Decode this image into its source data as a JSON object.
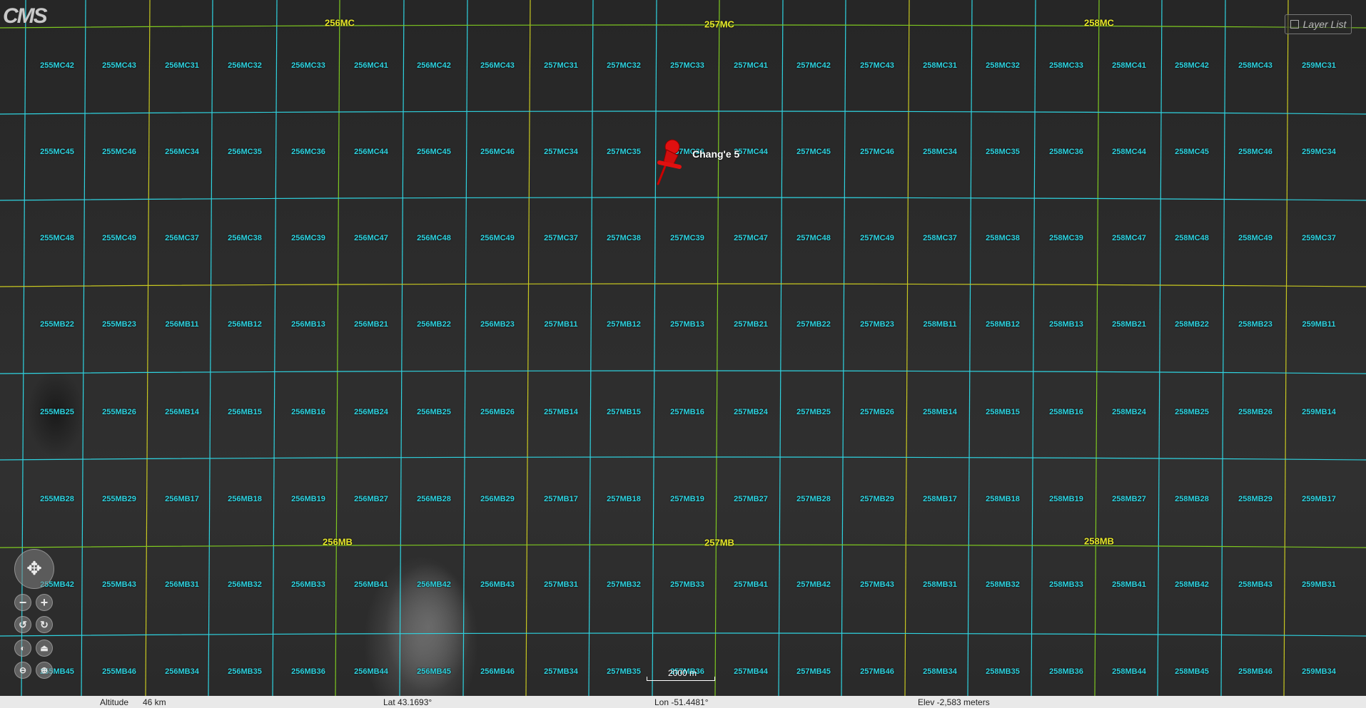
{
  "app": {
    "logo_text": "CMS"
  },
  "layer_list": {
    "label": "Layer List"
  },
  "marker": {
    "label": "Chang'e 5",
    "color": "#e01010"
  },
  "grid": {
    "col_x": [
      40,
      120,
      208,
      298,
      388,
      476,
      565,
      655,
      743,
      831,
      920,
      1008,
      1097,
      1185,
      1274,
      1362,
      1451,
      1540,
      1628,
      1717,
      1805,
      1895
    ],
    "row_y": [
      35,
      158,
      278,
      400,
      520,
      643,
      765,
      888,
      976
    ],
    "colors": {
      "tile": "#2fd3e0",
      "block": "#c8c820",
      "major": "#7ec820"
    },
    "rows": [
      [
        "255MC42",
        "255MC43",
        "256MC31",
        "256MC32",
        "256MC33",
        "256MC41",
        "256MC42",
        "256MC43",
        "257MC31",
        "257MC32",
        "257MC33",
        "257MC41",
        "257MC42",
        "257MC43",
        "258MC31",
        "258MC32",
        "258MC33",
        "258MC41",
        "258MC42",
        "258MC43",
        "259MC31"
      ],
      [
        "255MC45",
        "255MC46",
        "256MC34",
        "256MC35",
        "256MC36",
        "256MC44",
        "256MC45",
        "256MC46",
        "257MC34",
        "257MC35",
        "257MC36",
        "257MC44",
        "257MC45",
        "257MC46",
        "258MC34",
        "258MC35",
        "258MC36",
        "258MC44",
        "258MC45",
        "258MC46",
        "259MC34"
      ],
      [
        "255MC48",
        "255MC49",
        "256MC37",
        "256MC38",
        "256MC39",
        "256MC47",
        "256MC48",
        "256MC49",
        "257MC37",
        "257MC38",
        "257MC39",
        "257MC47",
        "257MC48",
        "257MC49",
        "258MC37",
        "258MC38",
        "258MC39",
        "258MC47",
        "258MC48",
        "258MC49",
        "259MC37"
      ],
      [
        "255MB22",
        "255MB23",
        "256MB11",
        "256MB12",
        "256MB13",
        "256MB21",
        "256MB22",
        "256MB23",
        "257MB11",
        "257MB12",
        "257MB13",
        "257MB21",
        "257MB22",
        "257MB23",
        "258MB11",
        "258MB12",
        "258MB13",
        "258MB21",
        "258MB22",
        "258MB23",
        "259MB11"
      ],
      [
        "255MB25",
        "255MB26",
        "256MB14",
        "256MB15",
        "256MB16",
        "256MB24",
        "256MB25",
        "256MB26",
        "257MB14",
        "257MB15",
        "257MB16",
        "257MB24",
        "257MB25",
        "257MB26",
        "258MB14",
        "258MB15",
        "258MB16",
        "258MB24",
        "258MB25",
        "258MB26",
        "259MB14"
      ],
      [
        "255MB28",
        "255MB29",
        "256MB17",
        "256MB18",
        "256MB19",
        "256MB27",
        "256MB28",
        "256MB29",
        "257MB17",
        "257MB18",
        "257MB19",
        "257MB27",
        "257MB28",
        "257MB29",
        "258MB17",
        "258MB18",
        "258MB19",
        "258MB27",
        "258MB28",
        "258MB29",
        "259MB17"
      ],
      [
        "255MB42",
        "255MB43",
        "256MB31",
        "256MB32",
        "256MB33",
        "256MB41",
        "256MB42",
        "256MB43",
        "257MB31",
        "257MB32",
        "257MB33",
        "257MB41",
        "257MB42",
        "257MB43",
        "258MB31",
        "258MB32",
        "258MB33",
        "258MB41",
        "258MB42",
        "258MB43",
        "259MB31"
      ],
      [
        "255MB45",
        "255MB46",
        "256MB34",
        "256MB35",
        "256MB36",
        "256MB44",
        "256MB45",
        "256MB46",
        "257MB34",
        "257MB35",
        "257MB36",
        "257MB44",
        "257MB45",
        "257MB46",
        "258MB34",
        "258MB35",
        "258MB36",
        "258MB44",
        "258MB45",
        "258MB46",
        "259MB34"
      ]
    ],
    "blocks": [
      "256MC",
      "257MC",
      "258MC",
      "256MB",
      "257MB",
      "258MB"
    ]
  },
  "scale": {
    "label": "2000 m"
  },
  "status": {
    "altitude_label": "Altitude",
    "altitude_value": "46 km",
    "lat": "Lat 43.1693°",
    "lon": "Lon -51.4481°",
    "elev": "Elev  -2,583 meters"
  },
  "nav_controls": {
    "zoom_in": "+",
    "zoom_out": "−"
  }
}
